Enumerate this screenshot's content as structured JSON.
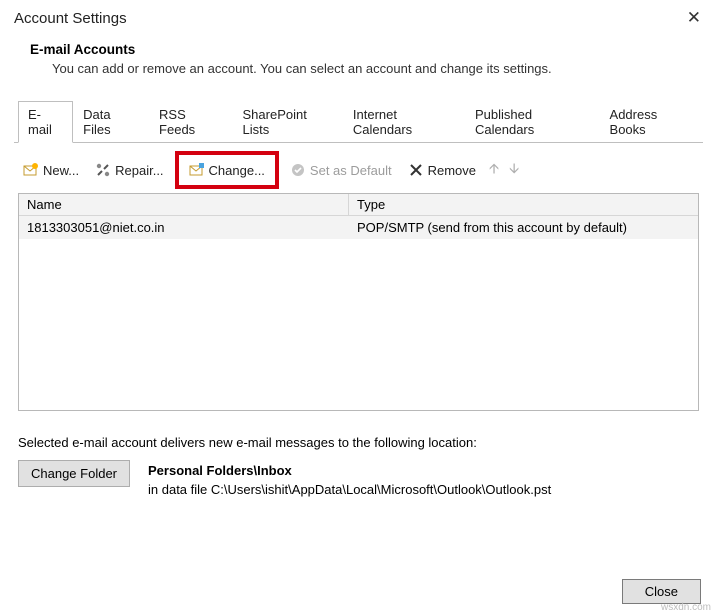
{
  "window": {
    "title": "Account Settings"
  },
  "header": {
    "title": "E-mail Accounts",
    "description": "You can add or remove an account. You can select an account and change its settings."
  },
  "tabs": [
    {
      "label": "E-mail",
      "active": true
    },
    {
      "label": "Data Files"
    },
    {
      "label": "RSS Feeds"
    },
    {
      "label": "SharePoint Lists"
    },
    {
      "label": "Internet Calendars"
    },
    {
      "label": "Published Calendars"
    },
    {
      "label": "Address Books"
    }
  ],
  "toolbar": {
    "new": "New...",
    "repair": "Repair...",
    "change": "Change...",
    "set_default": "Set as Default",
    "remove": "Remove"
  },
  "list": {
    "columns": {
      "name": "Name",
      "type": "Type"
    },
    "rows": [
      {
        "name": "1813303051@niet.co.in",
        "type": "POP/SMTP (send from this account by default)"
      }
    ]
  },
  "delivery": {
    "label": "Selected e-mail account delivers new e-mail messages to the following location:",
    "change_btn": "Change Folder",
    "location_path": "Personal Folders\\Inbox",
    "location_file": "in data file C:\\Users\\ishit\\AppData\\Local\\Microsoft\\Outlook\\Outlook.pst"
  },
  "footer": {
    "close": "Close"
  },
  "watermark": "wsxdn.com"
}
